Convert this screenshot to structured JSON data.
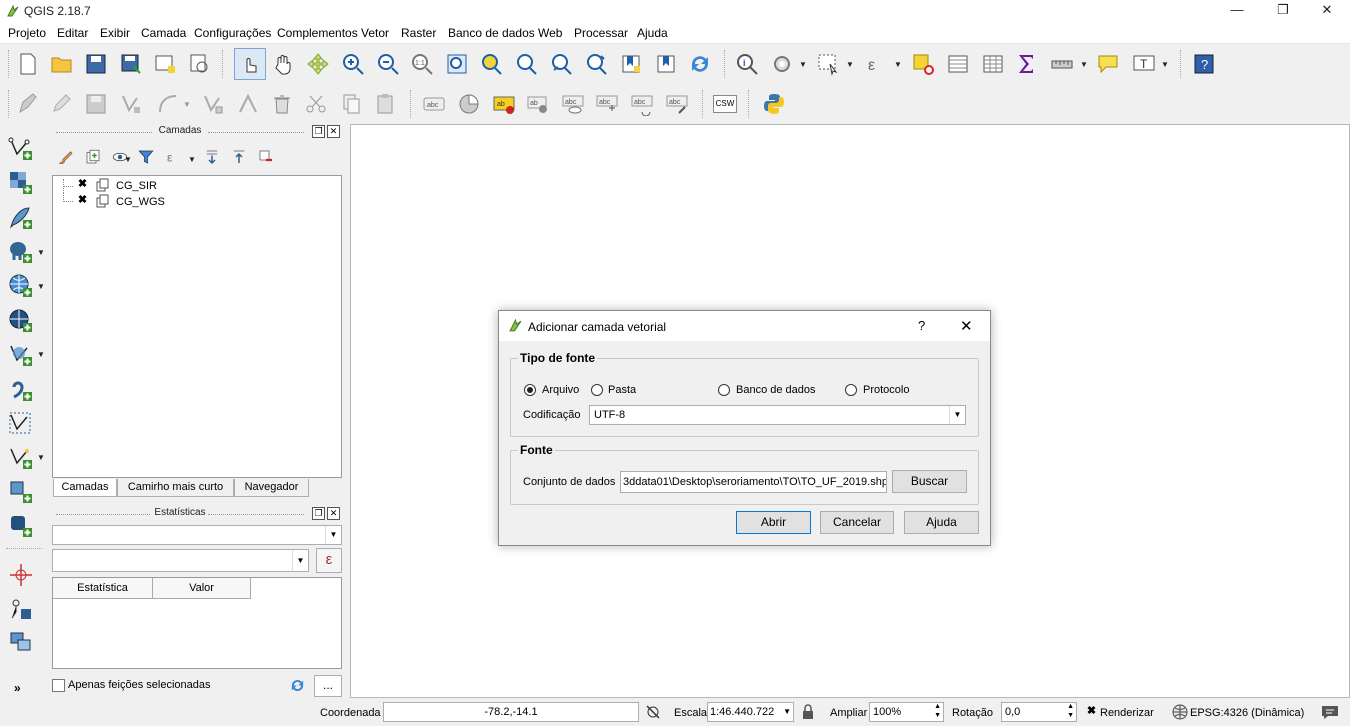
{
  "app": {
    "title": "QGIS 2.18.7",
    "icon": "qgis-logo-icon"
  },
  "window_controls": {
    "minimize": "—",
    "maximize": "❐",
    "close": "✕"
  },
  "menu": [
    "Projeto",
    "Editar",
    "Exibir",
    "Camada",
    "Configurações",
    "Complementos",
    "Vetor",
    "Raster",
    "Banco de dados",
    "Web",
    "Processar",
    "Ajuda"
  ],
  "toolbar2": {
    "csw_label": "CSW"
  },
  "layers_panel": {
    "title": "Camadas",
    "layers": [
      {
        "name": "CG_SIR",
        "checked": "✖"
      },
      {
        "name": "CG_WGS",
        "checked": "✖"
      }
    ],
    "tabs": [
      "Camadas",
      "Camirho mais curto",
      "Navegador"
    ]
  },
  "stats_panel": {
    "title": "Estatísticas",
    "expr_button": "ε",
    "columns": [
      "Estatística",
      "Valor"
    ],
    "only_selected_label": "Apenas feições selecionadas",
    "more_button": "...",
    "collapse_glyph": "»"
  },
  "statusbar": {
    "coord_label": "Coordenada",
    "coord_value": "-78.2,-14.1",
    "scale_label": "Escala",
    "scale_value": "1:46.440.722",
    "magnify_label": "Ampliar",
    "magnify_value": "100%",
    "rotation_label": "Rotação",
    "rotation_value": "0,0",
    "render_label": "Renderizar",
    "render_check": "✖",
    "crs_label": "EPSG:4326 (Dinâmica)"
  },
  "dialog": {
    "title": "Adicionar camada vetorial",
    "help_glyph": "?",
    "close_glyph": "✕",
    "source_type_group": "Tipo de fonte",
    "source_types": [
      "Arquivo",
      "Pasta",
      "Banco de dados",
      "Protocolo"
    ],
    "selected_source_type": "Arquivo",
    "encoding_label": "Codificação",
    "encoding_value": "UTF-8",
    "source_group": "Fonte",
    "dataset_label": "Conjunto de dados",
    "dataset_value": "3ddata01\\Desktop\\seroriamento\\TO\\TO_UF_2019.shp",
    "browse_button": "Buscar",
    "buttons": {
      "open": "Abrir",
      "cancel": "Cancelar",
      "help": "Ajuda"
    }
  },
  "colors": {
    "accent": "#0078d7",
    "qgis_green": "#589632",
    "qgis_yellow": "#ee7913"
  }
}
